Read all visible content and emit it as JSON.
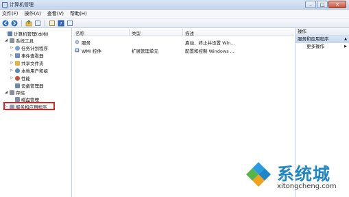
{
  "window": {
    "title": "计算机管理"
  },
  "menu": [
    "文件(F)",
    "操作(A)",
    "查看(V)",
    "帮助(H)"
  ],
  "tree": [
    {
      "label": "计算机管理(本地)",
      "indent": 0,
      "expander": "",
      "icon": "computer-icon",
      "color": "#5b7fb0"
    },
    {
      "label": "系统工具",
      "indent": 1,
      "expander": "◢",
      "icon": "tools-icon",
      "color": "#8a8f99"
    },
    {
      "label": "任务计划程序",
      "indent": 2,
      "expander": "▷",
      "icon": "clock-icon",
      "color": "#7aa0cf"
    },
    {
      "label": "事件查看器",
      "indent": 2,
      "expander": "▷",
      "icon": "event-viewer-icon",
      "color": "#6f8fb6"
    },
    {
      "label": "共享文件夹",
      "indent": 2,
      "expander": "▷",
      "icon": "folder-icon",
      "color": "#e3b64b"
    },
    {
      "label": "本地用户和组",
      "indent": 2,
      "expander": "▷",
      "icon": "users-icon",
      "color": "#5d84c0"
    },
    {
      "label": "性能",
      "indent": 2,
      "expander": "▷",
      "icon": "performance-icon",
      "color": "#c9503c"
    },
    {
      "label": "设备管理器",
      "indent": 2,
      "expander": "",
      "icon": "device-manager-icon",
      "color": "#6d86a8"
    },
    {
      "label": "存储",
      "indent": 1,
      "expander": "◢",
      "icon": "storage-icon",
      "color": "#8a8f99"
    },
    {
      "label": "磁盘管理",
      "indent": 2,
      "expander": "",
      "icon": "disk-icon",
      "color": "#7c8ea6"
    },
    {
      "label": "服务和应用程序",
      "indent": 1,
      "expander": "▷",
      "icon": "services-apps-icon",
      "color": "#8a9bb3"
    }
  ],
  "list": {
    "columns": [
      "名称",
      "类型",
      "描述"
    ],
    "rows": [
      {
        "name": "服务",
        "type": "",
        "desc": "启动、终止并设置 Win...",
        "icon": "gear-icon",
        "color": "#8ea2bd"
      },
      {
        "name": "WMI 控件",
        "type": "扩展管理单元",
        "desc": "配置和控制 Windows ...",
        "icon": "wmi-icon",
        "color": "#6e87ad"
      }
    ]
  },
  "actions": {
    "header": "操作",
    "section": "服务和应用程序",
    "section_arrow": "▲",
    "more": "更多操作",
    "more_arrow": "▶"
  },
  "watermark": {
    "brand": "系统城",
    "url": "xitongcheng.com"
  }
}
